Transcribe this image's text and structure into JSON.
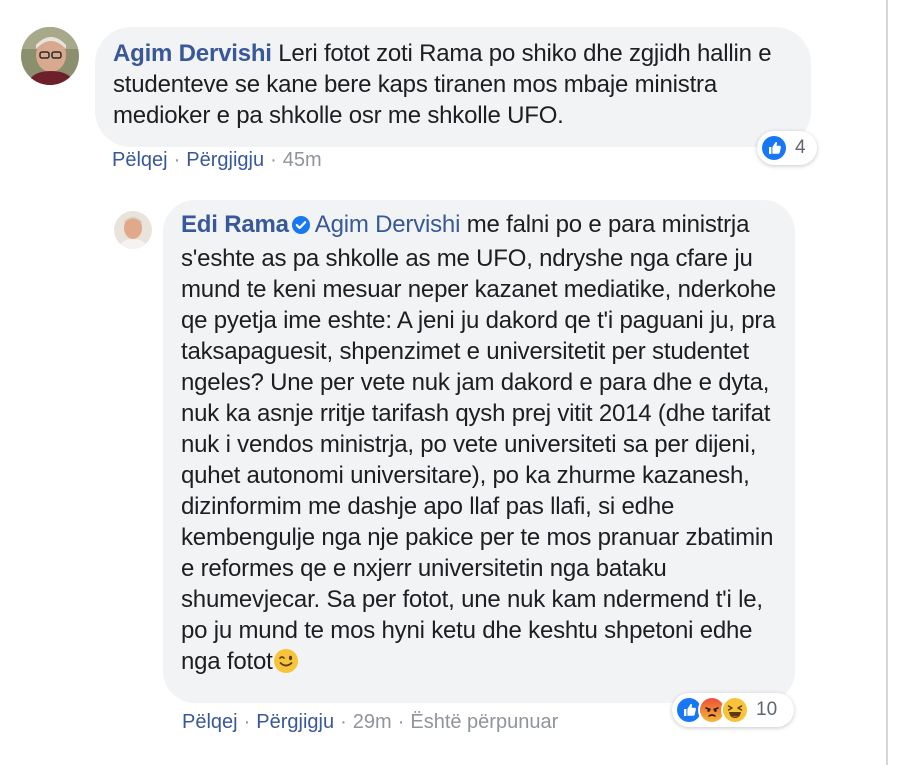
{
  "comment1": {
    "author": "Agim Dervishi",
    "text": "Leri fotot zoti Rama po shiko dhe zgjidh hallin e studenteve se kane bere kaps tiranen mos mbaje ministra medioker e pa shkolle osr me shkolle UFO.",
    "avatar_icon": "user-avatar-photo",
    "reaction_icons": [
      "like-icon"
    ],
    "reaction_count": "4",
    "actions": {
      "like": "Pëlqej",
      "reply": "Përgjigju",
      "time": "45m"
    }
  },
  "reply1": {
    "author": "Edi Rama",
    "verified_icon": "verified-badge-icon",
    "mention": "Agim Dervishi",
    "text": "me falni po e para ministrja s'eshte as pa shkolle as me UFO, ndryshe nga cfare ju mund te keni mesuar neper kazanet mediatike, nderkohe qe pyetja ime eshte: A jeni ju dakord qe t'i paguani ju, pra taksapaguesit, shpenzimet e universitetit per studentet ngeles? Une per vete nuk jam dakord e para dhe e dyta, nuk ka asnje rritje tarifash qysh prej vitit 2014 (dhe tarifat nuk i vendos ministrja, po vete universiteti sa per dijeni, quhet autonomi universitare), po ka zhurme kazanesh, dizinformim me dashje apo llaf pas llafi, si edhe kembengulje nga nje pakice per te mos pranuar zbatimin e reformes qe e nxjerr universitetin nga bataku shumevjecar. Sa per fotot, une nuk kam ndermend t'i le, po ju mund te mos hyni ketu dhe keshtu shpetoni edhe nga fotot",
    "trailing_emoji": "wink-emoji",
    "avatar_icon": "user-avatar-photo",
    "reaction_icons": [
      "like-icon",
      "angry-icon",
      "haha-icon"
    ],
    "reaction_count": "10",
    "actions": {
      "like": "Pëlqej",
      "reply": "Përgjigju",
      "time": "29m",
      "edited": "Është përpunuar"
    }
  },
  "colors": {
    "bubble_bg": "#f2f3f5",
    "author_link": "#385898",
    "body_text": "#1c1e21",
    "meta_text": "#90949c",
    "like_blue": "#1877f2"
  }
}
